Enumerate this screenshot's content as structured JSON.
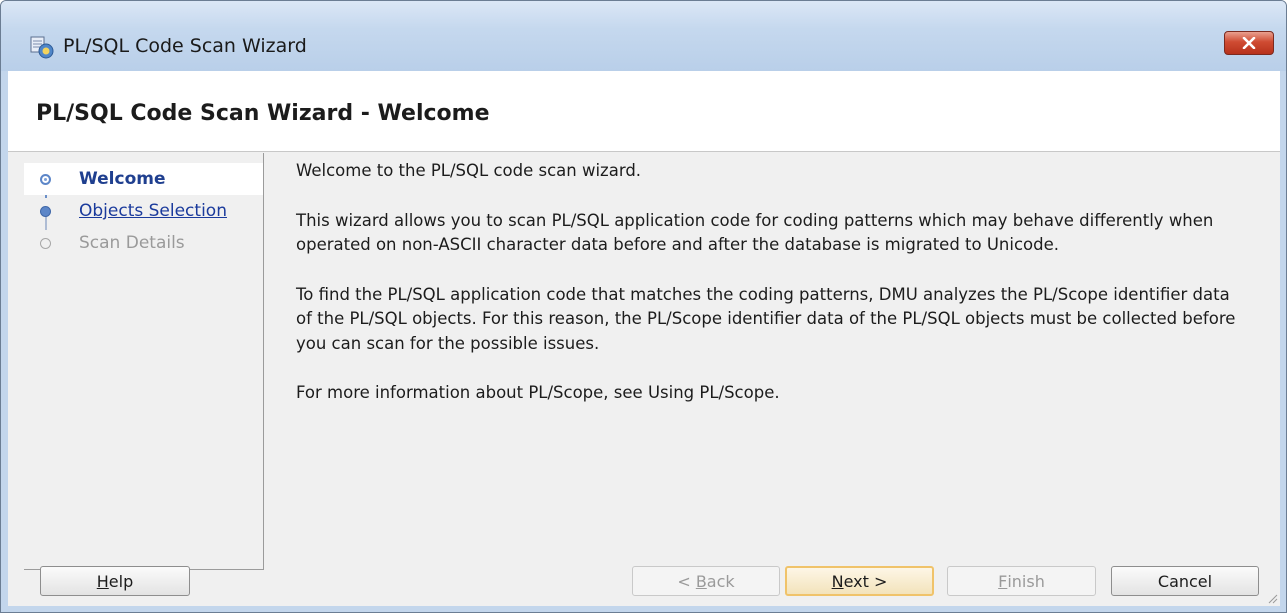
{
  "window": {
    "title": "PL/SQL Code Scan Wizard"
  },
  "header": {
    "title": "PL/SQL Code Scan Wizard - Welcome"
  },
  "steps": [
    {
      "label": "Welcome",
      "state": "current"
    },
    {
      "label": "Objects Selection",
      "state": "link"
    },
    {
      "label": "Scan Details",
      "state": "disabled"
    }
  ],
  "content": {
    "paragraphs": [
      "Welcome to the PL/SQL code scan wizard.",
      "This wizard allows you to scan PL/SQL application code for coding patterns which may behave differently when operated on non-ASCII character data before and after the database is migrated to Unicode.",
      "To find the PL/SQL application code that matches the coding patterns, DMU analyzes the PL/Scope identifier data of the PL/SQL objects. For this reason, the PL/Scope identifier data of the PL/SQL objects must be collected before you can scan for the possible issues.",
      "For more information about PL/Scope, see Using PL/Scope."
    ]
  },
  "buttons": {
    "help": {
      "mnemonic": "H",
      "rest": "elp"
    },
    "back": {
      "prefix": "< ",
      "mnemonic": "B",
      "rest": "ack"
    },
    "next": {
      "mnemonic": "N",
      "rest": "ext >"
    },
    "finish": {
      "mnemonic": "F",
      "rest": "inish"
    },
    "cancel": "Cancel"
  },
  "colors": {
    "accent": "#1f3f8f",
    "link": "#1a3a9c",
    "disabled": "#9a9a9a",
    "close_red": "#c9442c"
  },
  "icons": {
    "title": "wizard-app-icon",
    "close": "close-icon",
    "step": "step-bullet-icon",
    "grip": "resize-grip-icon"
  }
}
